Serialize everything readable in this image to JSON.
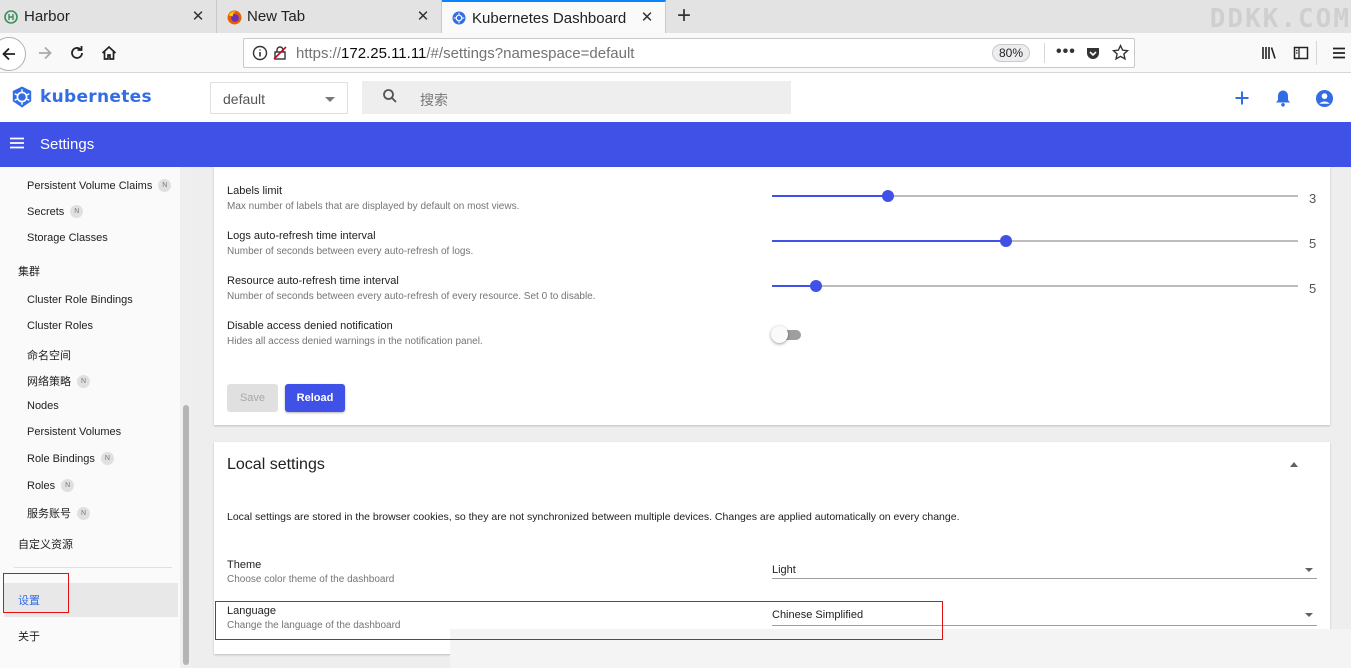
{
  "browser": {
    "tabs": [
      {
        "title": "Harbor"
      },
      {
        "title": "New Tab"
      },
      {
        "title": "Kubernetes Dashboard"
      }
    ],
    "url_prefix": "https://",
    "url_host": "172.25.11.11",
    "url_path": "/#/settings?namespace=default",
    "zoom": "80%"
  },
  "header": {
    "logo": "kubernetes",
    "namespace": "default",
    "search_placeholder": "搜索"
  },
  "toolbar": {
    "title": "Settings"
  },
  "sidebar": {
    "items": [
      {
        "label": "Persistent Volume Claims",
        "badge": "N"
      },
      {
        "label": "Secrets",
        "badge": "N"
      },
      {
        "label": "Storage Classes"
      },
      {
        "label": "Cluster Role Bindings"
      },
      {
        "label": "Cluster Roles"
      },
      {
        "label": "命名空间"
      },
      {
        "label": "网络策略",
        "badge": "N"
      },
      {
        "label": "Nodes"
      },
      {
        "label": "Persistent Volumes"
      },
      {
        "label": "Role Bindings",
        "badge": "N"
      },
      {
        "label": "Roles",
        "badge": "N"
      },
      {
        "label": "服务账号",
        "badge": "N"
      }
    ],
    "section_cluster": "集群",
    "custom_resources": "自定义资源",
    "settings": "设置",
    "about": "关于"
  },
  "global_settings": {
    "labels_limit": {
      "label": "Labels limit",
      "desc": "Max number of labels that are displayed by default on most views.",
      "value": "3",
      "fraction": 0.22
    },
    "logs_refresh": {
      "label": "Logs auto-refresh time interval",
      "desc": "Number of seconds between every auto-refresh of logs.",
      "value": "5",
      "fraction": 0.444
    },
    "resource_refresh": {
      "label": "Resource auto-refresh time interval",
      "desc": "Number of seconds between every auto-refresh of every resource. Set 0 to disable.",
      "value": "5",
      "fraction": 0.083
    },
    "disable_access": {
      "label": "Disable access denied notification",
      "desc": "Hides all access denied warnings in the notification panel.",
      "enabled": false
    },
    "save": "Save",
    "reload": "Reload"
  },
  "local_settings": {
    "title": "Local settings",
    "info": "Local settings are stored in the browser cookies, so they are not synchronized between multiple devices. Changes are applied automatically on every change.",
    "theme": {
      "label": "Theme",
      "desc": "Choose color theme of the dashboard",
      "value": "Light"
    },
    "language": {
      "label": "Language",
      "desc": "Change the language of the dashboard",
      "value": "Chinese Simplified"
    }
  },
  "colors": {
    "primary": "#3f51e6",
    "highlight_box": "#e01010"
  }
}
